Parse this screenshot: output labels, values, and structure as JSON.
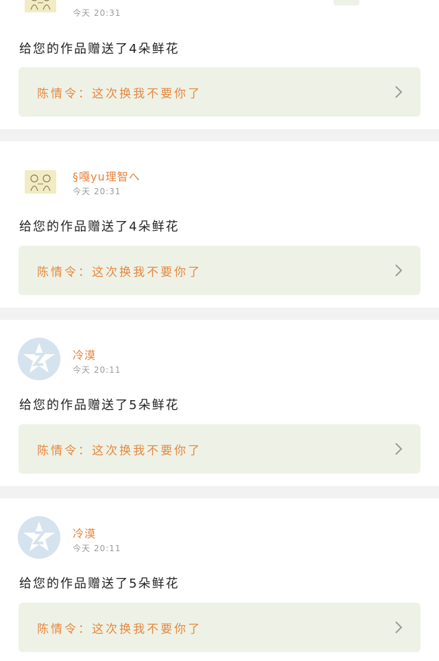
{
  "notifications": [
    {
      "username": "",
      "avatar": "sketch-avatar",
      "time": "今天 20:31",
      "message": "给您的作品赠送了4朵鲜花",
      "work_title": "陈情令：这次换我不要你了",
      "link_icon": "chevron-right-icon"
    },
    {
      "username": "§嘎yu理智へ",
      "avatar": "sketch-avatar",
      "time": "今天 20:31",
      "message": "给您的作品赠送了4朵鲜花",
      "work_title": "陈情令：这次换我不要你了",
      "link_icon": "chevron-right-icon"
    },
    {
      "username": "冷漠",
      "avatar": "qzone-default-avatar",
      "time": "今天 20:11",
      "message": "给您的作品赠送了5朵鲜花",
      "work_title": "陈情令：这次换我不要你了",
      "link_icon": "chevron-right-icon"
    },
    {
      "username": "冷漠",
      "avatar": "qzone-default-avatar",
      "time": "今天 20:11",
      "message": "给您的作品赠送了5朵鲜花",
      "work_title": "陈情令：这次换我不要你了",
      "link_icon": "chevron-right-icon"
    }
  ],
  "colors": {
    "username": "#e9823b",
    "work_title": "#e7873f",
    "work_box_bg": "#eef2e6",
    "divider_bg": "#f2f2f2",
    "time": "#9a9a9a"
  }
}
